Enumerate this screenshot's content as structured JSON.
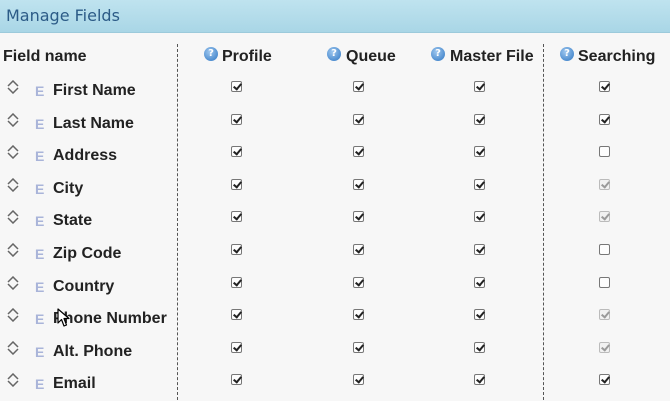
{
  "panel": {
    "title": "Manage Fields"
  },
  "columns": {
    "field_name": "Field name",
    "headers": [
      {
        "key": "profile",
        "label": "Profile",
        "help_icon": "question-circle-icon"
      },
      {
        "key": "queue",
        "label": "Queue",
        "help_icon": "question-circle-icon"
      },
      {
        "key": "master_file",
        "label": "Master File",
        "help_icon": "question-circle-icon"
      },
      {
        "key": "searching",
        "label": "Searching",
        "help_icon": "question-circle-icon"
      }
    ]
  },
  "row_icons": {
    "drag": "sort-arrows-icon",
    "edit_marker": "E"
  },
  "fields": [
    {
      "label": "First Name",
      "profile": {
        "checked": true
      },
      "queue": {
        "checked": true
      },
      "master_file": {
        "checked": true
      },
      "searching": {
        "checked": true,
        "disabled": false
      }
    },
    {
      "label": "Last Name",
      "profile": {
        "checked": true
      },
      "queue": {
        "checked": true
      },
      "master_file": {
        "checked": true
      },
      "searching": {
        "checked": true,
        "disabled": false
      }
    },
    {
      "label": "Address",
      "profile": {
        "checked": true
      },
      "queue": {
        "checked": true
      },
      "master_file": {
        "checked": true
      },
      "searching": {
        "checked": false,
        "disabled": false
      }
    },
    {
      "label": "City",
      "profile": {
        "checked": true
      },
      "queue": {
        "checked": true
      },
      "master_file": {
        "checked": true
      },
      "searching": {
        "checked": true,
        "disabled": true
      }
    },
    {
      "label": "State",
      "profile": {
        "checked": true
      },
      "queue": {
        "checked": true
      },
      "master_file": {
        "checked": true
      },
      "searching": {
        "checked": true,
        "disabled": true
      }
    },
    {
      "label": "Zip Code",
      "profile": {
        "checked": true
      },
      "queue": {
        "checked": true
      },
      "master_file": {
        "checked": true
      },
      "searching": {
        "checked": false,
        "disabled": false
      }
    },
    {
      "label": "Country",
      "profile": {
        "checked": true
      },
      "queue": {
        "checked": true
      },
      "master_file": {
        "checked": true
      },
      "searching": {
        "checked": false,
        "disabled": false
      }
    },
    {
      "label": "Phone Number",
      "profile": {
        "checked": true
      },
      "queue": {
        "checked": true
      },
      "master_file": {
        "checked": true
      },
      "searching": {
        "checked": true,
        "disabled": true
      }
    },
    {
      "label": "Alt. Phone",
      "profile": {
        "checked": true
      },
      "queue": {
        "checked": true
      },
      "master_file": {
        "checked": true
      },
      "searching": {
        "checked": true,
        "disabled": true
      }
    },
    {
      "label": "Email",
      "profile": {
        "checked": true
      },
      "queue": {
        "checked": true
      },
      "master_file": {
        "checked": true
      },
      "searching": {
        "checked": true,
        "disabled": false
      }
    }
  ],
  "colors": {
    "title_bar": "#a9d6e6",
    "title_text": "#2c5b87",
    "edit_marker": "#a9b4d9",
    "help_icon": "#4f8ed0"
  }
}
